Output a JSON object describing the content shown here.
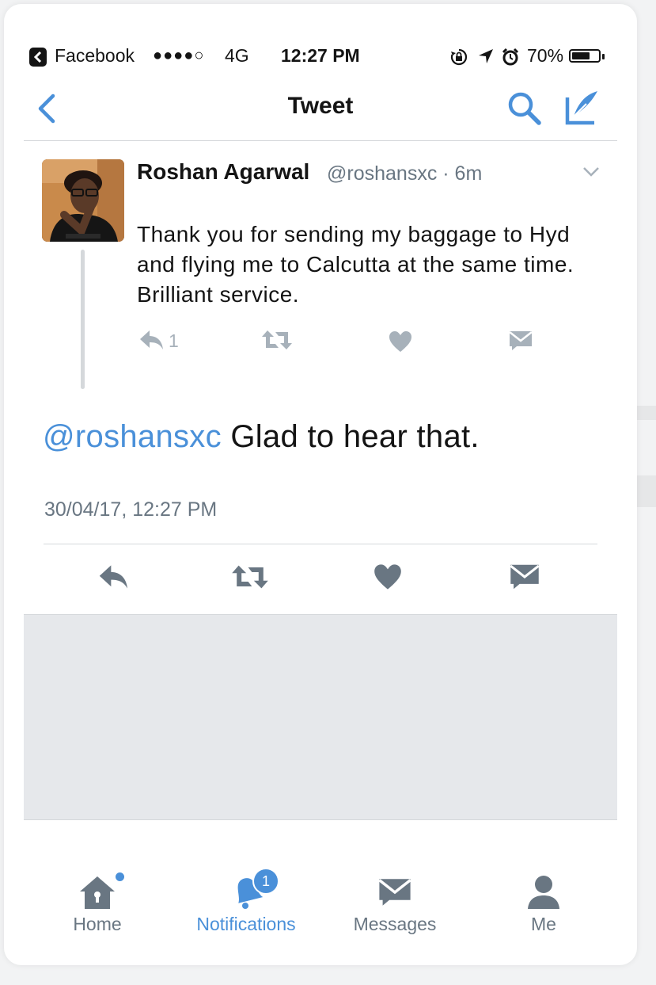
{
  "status_bar": {
    "carrier": "Facebook",
    "signal": "●●●●○",
    "network": "4G",
    "time": "12:27 PM",
    "battery_percent": "70%",
    "battery_level": 0.7
  },
  "nav": {
    "title": "Tweet"
  },
  "quoted_tweet": {
    "author_name": "Roshan Agarwal",
    "handle_time": "@roshansxc · 6m",
    "text": "Thank you for sending my baggage to Hyd and flying me to Calcutta at the same time. Brilliant service.",
    "reply_count": "1"
  },
  "main_tweet": {
    "mention": "@roshansxc",
    "text": " Glad to hear that.",
    "timestamp": "30/04/17, 12:27 PM"
  },
  "tab_bar": {
    "tabs": [
      {
        "label": "Home",
        "icon": "home-icon"
      },
      {
        "label": "Notifications",
        "icon": "bell-icon",
        "badge": "1"
      },
      {
        "label": "Messages",
        "icon": "envelope-icon"
      },
      {
        "label": "Me",
        "icon": "person-icon"
      }
    ]
  },
  "colors": {
    "accent": "#4a90d9",
    "text": "#141414",
    "secondary_text": "#697682",
    "icon_gray": "#697682",
    "light_icon": "#a7b1ba",
    "divider": "#d5d8db"
  }
}
